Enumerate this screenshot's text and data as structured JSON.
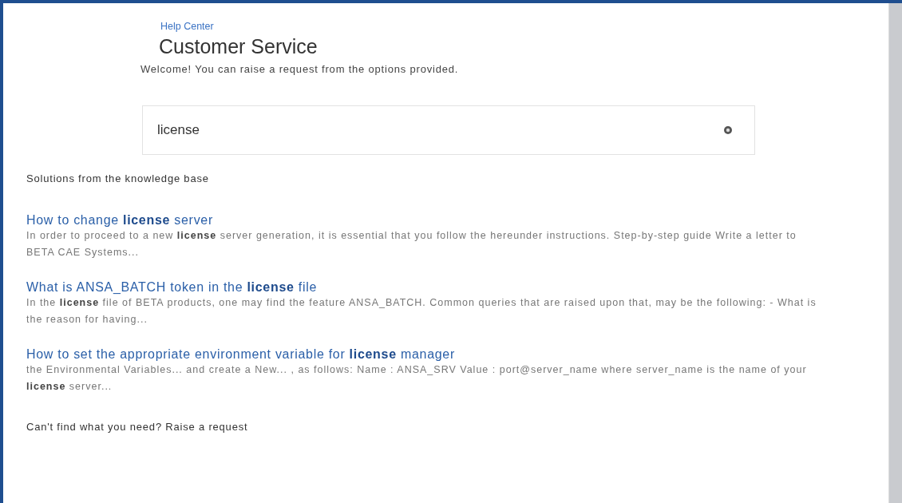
{
  "breadcrumb": "Help Center",
  "title": "Customer Service",
  "welcome": "Welcome! You can raise a request from the options provided.",
  "search": {
    "value": "license"
  },
  "results_heading": "Solutions from the knowledge base",
  "results": [
    {
      "title": "How to change **license** server",
      "excerpt": "In order to proceed to a new **license** server generation, it is essential that you follow the hereunder instructions. Step-by-step guide Write a letter to BETA CAE Systems..."
    },
    {
      "title": "What is ANSA_BATCH token in the **license** file",
      "excerpt": "In the **license** file of BETA products, one may find the feature ANSA_BATCH. Common queries that are raised upon that, may be the following: - What is the reason for having..."
    },
    {
      "title": "How to set the appropriate environment variable for **license** manager",
      "excerpt": "the Environmental Variables... and create a New... , as follows: Name : ANSA_SRV Value : port@server_name where server_name is the name of your **license** server..."
    }
  ],
  "footer_prompt": "Can't find what you need? Raise a request"
}
